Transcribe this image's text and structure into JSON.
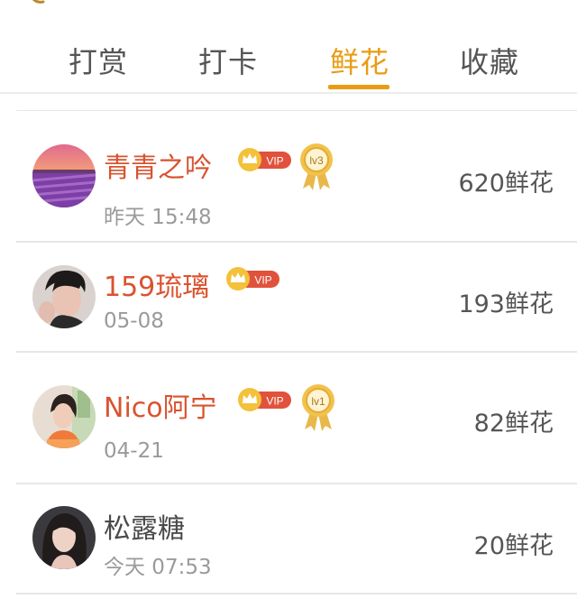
{
  "tabs": [
    {
      "label": "打赏",
      "active": false
    },
    {
      "label": "打卡",
      "active": false
    },
    {
      "label": "鲜花",
      "active": true
    },
    {
      "label": "收藏",
      "active": false
    }
  ],
  "colors": {
    "accent": "#e99c13",
    "vip_name": "#d9532f",
    "text": "#555555",
    "muted": "#9a9a9a"
  },
  "vip_badge_text": "VIP",
  "rows": [
    {
      "name": "青青之吟",
      "vip": true,
      "medal": "lv3",
      "time": "昨天 15:48",
      "amount": "620鲜花"
    },
    {
      "name": "159琉璃",
      "vip": true,
      "medal": "",
      "time": "05-08",
      "amount": "193鲜花"
    },
    {
      "name": "Nico阿宁",
      "vip": true,
      "medal": "lv1",
      "time": "04-21",
      "amount": "82鲜花"
    },
    {
      "name": "松露糖",
      "vip": false,
      "medal": "",
      "time": "今天 07:53",
      "amount": "20鲜花"
    }
  ]
}
